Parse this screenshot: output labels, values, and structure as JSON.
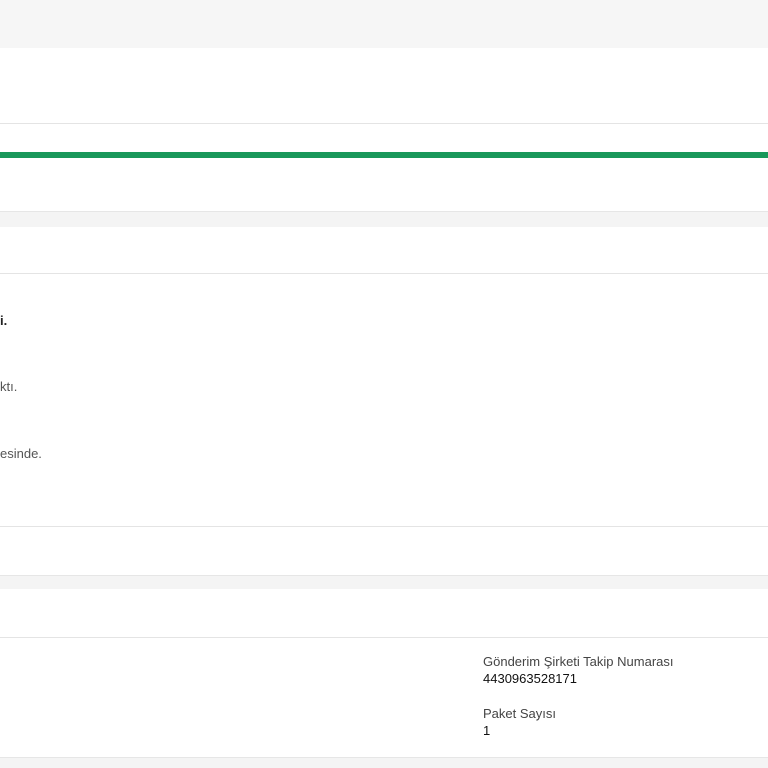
{
  "progress": {
    "value": 1.0,
    "color": "#19985a"
  },
  "timeline": {
    "events": [
      {
        "text": "i."
      },
      {
        "text": "ktı."
      },
      {
        "text": "esinde."
      }
    ]
  },
  "shipment": {
    "tracking": {
      "label": "Gönderim Şirketi Takip Numarası",
      "value": "4430963528171"
    },
    "packages": {
      "label": "Paket Sayısı",
      "value": "1"
    }
  }
}
